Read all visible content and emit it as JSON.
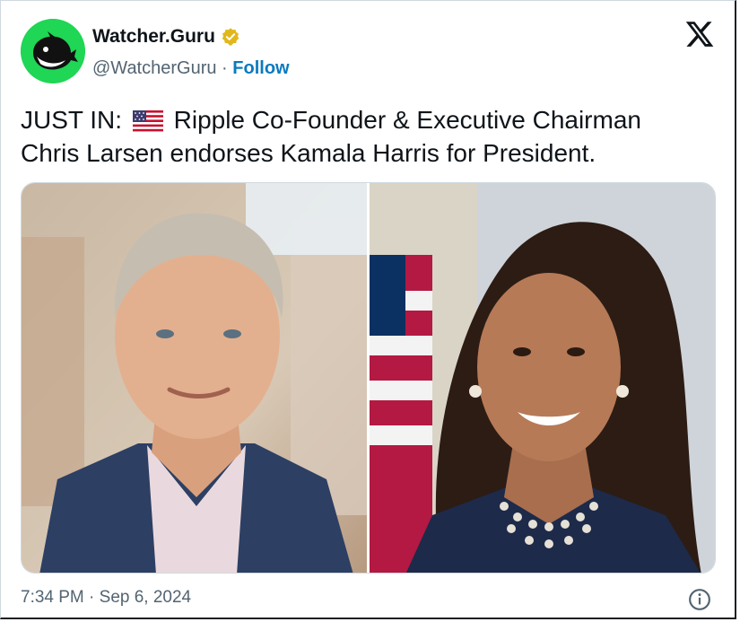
{
  "author": {
    "name": "Watcher.Guru",
    "handle": "@WatcherGuru",
    "separator": " · ",
    "follow_label": "Follow",
    "avatar_icon": "whale-logo-icon",
    "verified_icon": "verified-gold-badge-icon"
  },
  "tweet": {
    "text_before_flag": "JUST IN: ",
    "flag_icon": "us-flag-icon",
    "text_after_flag": " Ripple Co-Founder & Executive Chairman Chris Larsen endorses Kamala Harris for President."
  },
  "media": {
    "images": [
      {
        "subject": "photo-chris-larsen"
      },
      {
        "subject": "photo-kamala-harris"
      }
    ]
  },
  "footer": {
    "timestamp": "7:34 PM · Sep 6, 2024",
    "info_icon": "info-icon"
  },
  "colors": {
    "accent": "#0c7abf",
    "avatar_bg": "#1fd655",
    "text_primary": "#0f1419",
    "text_secondary": "#536471",
    "verified_gold": "#e2b719"
  }
}
